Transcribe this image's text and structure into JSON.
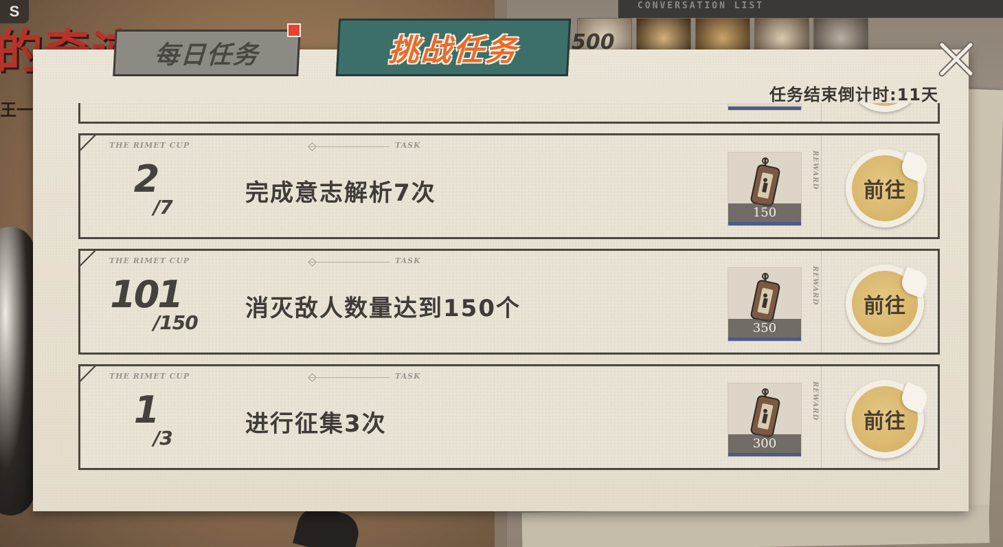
{
  "background": {
    "logo_badge": "S",
    "poster_title": "的奇迹",
    "poster_subtitle": "王一",
    "conversation_list_label": "CONVERSATION LIST",
    "conversation_counter": "500"
  },
  "tabs": {
    "daily": {
      "label": "每日任务",
      "has_badge": true
    },
    "challenge": {
      "label": "挑战任务",
      "active": true
    }
  },
  "countdown_text": "任务结束倒计时:11天",
  "colors": {
    "accent_orange": "#e86a2c",
    "tab_teal": "#3c6e6a",
    "badge_red": "#e8432e",
    "go_button_gold": "#d8b56a",
    "reward_bar_blue": "#4d5a86"
  },
  "card_labels": {
    "cup": "THE RIMET CUP",
    "task": "TASK",
    "reward": "REWARD"
  },
  "tasks": [
    {
      "current": "2",
      "total": "/7",
      "description": "完成意志解析7次",
      "reward_icon": "tag-medal-icon",
      "reward_qty": "150",
      "button_label": "前往"
    },
    {
      "current": "101",
      "total": "/150",
      "description": "消灭敌人数量达到150个",
      "reward_icon": "tag-medal-icon",
      "reward_qty": "350",
      "button_label": "前往"
    },
    {
      "current": "1",
      "total": "/3",
      "description": "进行征集3次",
      "reward_icon": "tag-medal-icon",
      "reward_qty": "300",
      "button_label": "前往"
    }
  ]
}
